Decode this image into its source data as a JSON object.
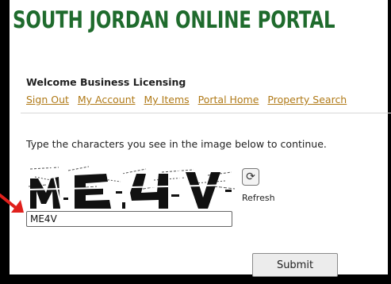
{
  "header": {
    "title": "SOUTH JORDAN ONLINE PORTAL"
  },
  "user": {
    "welcome": "Welcome Business Licensing"
  },
  "nav": {
    "items": [
      {
        "label": "Sign Out"
      },
      {
        "label": "My Account"
      },
      {
        "label": "My Items"
      },
      {
        "label": "Portal Home"
      },
      {
        "label": "Property Search"
      }
    ]
  },
  "captcha": {
    "instruction": "Type the characters you see in the image below to continue.",
    "image_icon": "distorted-captcha-image",
    "refresh_icon": "refresh-icon",
    "refresh_label": "Refresh",
    "input_value": "ME4V"
  },
  "form": {
    "submit_label": "Submit"
  },
  "colors": {
    "title": "#1f6b2d",
    "link": "#b07a18",
    "annotation_arrow": "#e0201c"
  }
}
